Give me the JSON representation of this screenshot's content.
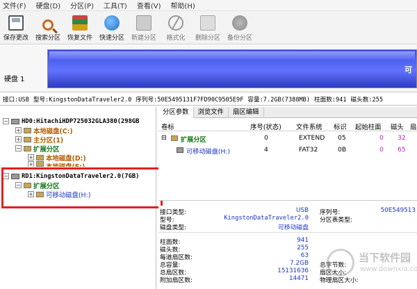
{
  "menu": [
    "文件(F)",
    "硬盘(D)",
    "分区(P)",
    "工具(T)",
    "查看(V)",
    "帮助(H)"
  ],
  "toolbar": [
    {
      "label": "保存更改",
      "icon": "save-icon"
    },
    {
      "label": "搜索分区",
      "icon": "search-icon"
    },
    {
      "label": "恢复文件",
      "icon": "recover-icon"
    },
    {
      "label": "快速分区",
      "icon": "quick-partition-icon"
    },
    {
      "label": "新建分区",
      "icon": "new-partition-icon"
    },
    {
      "label": "格式化",
      "icon": "format-icon"
    },
    {
      "label": "删除分区",
      "icon": "delete-icon"
    },
    {
      "label": "备份分区",
      "icon": "backup-icon"
    }
  ],
  "disk": {
    "label": "硬盘 1",
    "graphic_label": "可"
  },
  "info": {
    "interface": "接口:USB",
    "model": "型号:KingstonDataTraveler2.0",
    "serial": "序列号:50E5495131F7FD90C9505E9F",
    "capacity": "容量:7.2GB(7388MB)",
    "cylinders": "柱面数:941",
    "heads": "磁头数:255"
  },
  "tree": {
    "hd0": "HD0:HitachiHDP725032GLA380(298GB",
    "local_c": "本地磁盘(C:)",
    "primary": "主分区(1)",
    "extended": "扩展分区",
    "local_d": "本地磁盘(D:)",
    "local_e": "本地磁盘(E:)",
    "rd1": "RD1:KingstonDataTraveler2.0(7GB)",
    "rd1_extended": "扩展分区",
    "rd1_removable": "可移动磁盘(H:)"
  },
  "tabs": [
    "分区参数",
    "浏览文件",
    "扇区编辑"
  ],
  "table": {
    "headers": [
      "卷标",
      "序号(状态)",
      "文件系统",
      "标识",
      "起始柱面",
      "磁头",
      "扇"
    ],
    "rows": [
      {
        "name": "扩展分区",
        "index": "0",
        "fs": "EXTEND",
        "id": "05",
        "start": "0",
        "head": "32"
      },
      {
        "name": "可移动磁盘(H:)",
        "index": "4",
        "fs": "FAT32",
        "id": "0B",
        "start": "0",
        "head": "65"
      }
    ]
  },
  "details": {
    "interface_type": {
      "label": "接口类型:",
      "value": "USB"
    },
    "model": {
      "label": "型号:",
      "value": "KingstonDataTraveler2.0"
    },
    "disk_type": {
      "label": "磁盘类型:",
      "value": "可移动磁盘"
    },
    "serial": {
      "label": "序列号:",
      "value": "50E549513"
    },
    "partition_table": {
      "label": "分区表类型:",
      "value": ""
    },
    "cylinders": {
      "label": "柱面数:",
      "value": "941"
    },
    "heads": {
      "label": "磁头数:",
      "value": "255"
    },
    "sectors_per_track": {
      "label": "每道扇区数:",
      "value": "63"
    },
    "total_capacity": {
      "label": "总容量:",
      "value": "7.2GB"
    },
    "total_sectors": {
      "label": "总扇区数:",
      "value": "15131636"
    },
    "extra_sectors": {
      "label": "附加扇区数:",
      "value": "14471"
    },
    "total_bytes": {
      "label": "总字节数:",
      "value": ""
    },
    "sector_size": {
      "label": "扇区大小:",
      "value": ""
    },
    "physical_sector_size": {
      "label": "物理扇区大小:",
      "value": ""
    }
  },
  "watermark": {
    "title": "当下软件园",
    "url": "www.downxia.com"
  }
}
